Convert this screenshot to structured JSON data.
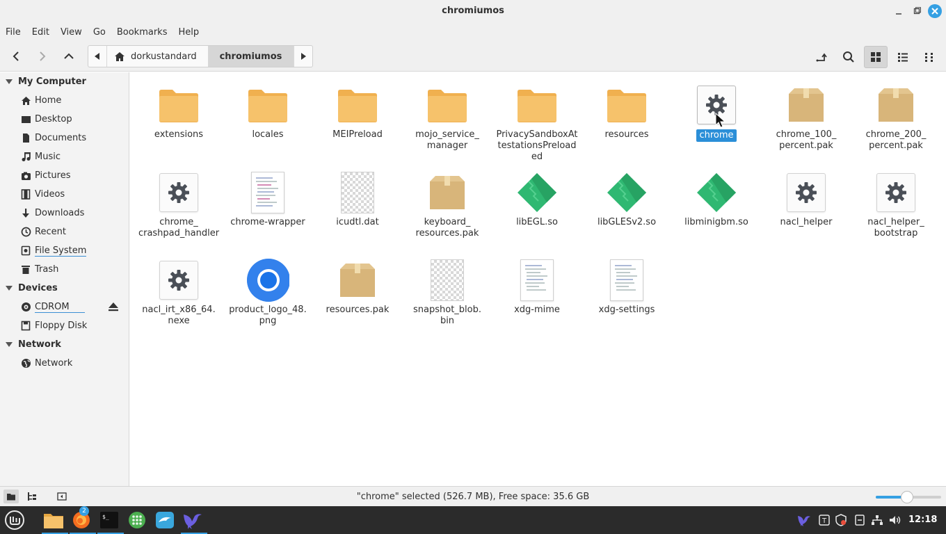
{
  "window": {
    "title": "chromiumos"
  },
  "menu": [
    "File",
    "Edit",
    "View",
    "Go",
    "Bookmarks",
    "Help"
  ],
  "path": {
    "home_label": "dorkustandard",
    "current": "chromiumos"
  },
  "sidebar": {
    "sections": [
      {
        "label": "My Computer"
      },
      {
        "label": "Devices"
      },
      {
        "label": "Network"
      }
    ],
    "my_computer": [
      {
        "label": "Home",
        "icon": "home-icon"
      },
      {
        "label": "Desktop",
        "icon": "desktop-icon"
      },
      {
        "label": "Documents",
        "icon": "documents-icon"
      },
      {
        "label": "Music",
        "icon": "music-icon"
      },
      {
        "label": "Pictures",
        "icon": "pictures-icon"
      },
      {
        "label": "Videos",
        "icon": "videos-icon"
      },
      {
        "label": "Downloads",
        "icon": "downloads-icon"
      },
      {
        "label": "Recent",
        "icon": "recent-icon"
      },
      {
        "label": "File System",
        "icon": "filesystem-icon"
      },
      {
        "label": "Trash",
        "icon": "trash-icon"
      }
    ],
    "devices": [
      {
        "label": "CDROM",
        "icon": "cdrom-icon"
      },
      {
        "label": "Floppy Disk",
        "icon": "floppy-icon"
      }
    ],
    "network": [
      {
        "label": "Network",
        "icon": "network-icon"
      }
    ]
  },
  "files": [
    {
      "name": "extensions",
      "type": "folder"
    },
    {
      "name": "locales",
      "type": "folder"
    },
    {
      "name": "MEIPreload",
      "type": "folder"
    },
    {
      "name": "mojo_service_\nmanager",
      "type": "folder"
    },
    {
      "name": "PrivacySandboxAt\ntestationsPreload\ned",
      "type": "folder"
    },
    {
      "name": "resources",
      "type": "folder"
    },
    {
      "name": "chrome",
      "type": "executable",
      "selected": true
    },
    {
      "name": "chrome_100_\npercent.pak",
      "type": "package"
    },
    {
      "name": "chrome_200_\npercent.pak",
      "type": "package"
    },
    {
      "name": "chrome_\ncrashpad_handler",
      "type": "executable"
    },
    {
      "name": "chrome-wrapper",
      "type": "script"
    },
    {
      "name": "icudtl.dat",
      "type": "data"
    },
    {
      "name": "keyboard_\nresources.pak",
      "type": "package"
    },
    {
      "name": "libEGL.so",
      "type": "library"
    },
    {
      "name": "libGLESv2.so",
      "type": "library"
    },
    {
      "name": "libminigbm.so",
      "type": "library"
    },
    {
      "name": "nacl_helper",
      "type": "executable"
    },
    {
      "name": "nacl_helper_\nbootstrap",
      "type": "executable"
    },
    {
      "name": "nacl_irt_x86_64.\nnexe",
      "type": "executable"
    },
    {
      "name": "product_logo_48.\npng",
      "type": "image"
    },
    {
      "name": "resources.pak",
      "type": "package"
    },
    {
      "name": "snapshot_blob.\nbin",
      "type": "data"
    },
    {
      "name": "xdg-mime",
      "type": "script"
    },
    {
      "name": "xdg-settings",
      "type": "script"
    }
  ],
  "status": {
    "text": "\"chrome\" selected (526.7 MB), Free space: 35.6 GB",
    "zoom_level": 0.48
  },
  "taskbar": {
    "badge_count": "2",
    "clock": "12:18"
  },
  "colors": {
    "accent": "#35a0e3",
    "folder": "#f6c26b",
    "package": "#d8b57a",
    "library": "#2fb872",
    "selection": "#2b8fd8"
  }
}
